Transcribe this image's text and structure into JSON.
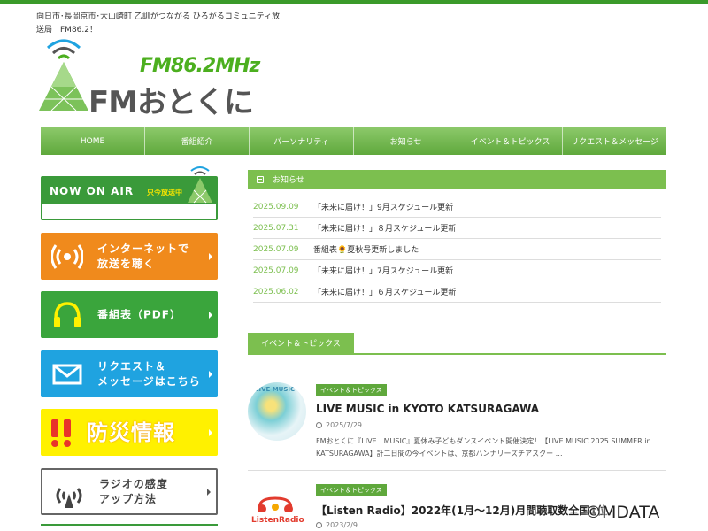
{
  "header": {
    "tagline": "向日市･長岡京市･大山崎町 乙訓がつながる ひろがるコミュニティ放送局　FM86.2！",
    "logo_frequency": "FM86.2MHz",
    "logo_name": "FMおとくに"
  },
  "nav": {
    "items": [
      "HOME",
      "番組紹介",
      "パーソナリティ",
      "お知らせ",
      "イベント＆トピックス",
      "リクエスト＆メッセージ"
    ]
  },
  "sidebar": {
    "onair_title": "NOW ON AIR",
    "onair_live": "只今放送中",
    "internet_label": "インターネットで\n放送を聴く",
    "program_label": "番組表（PDF）",
    "request_label": "リクエスト＆\nメッセージはこちら",
    "disaster_label": "防災情報",
    "radio_label": "ラジオの感度\nアップ方法"
  },
  "news": {
    "heading": "お知らせ",
    "items": [
      {
        "date": "2025.09.09",
        "title": "「未来に届け！」9月スケジュール更新"
      },
      {
        "date": "2025.07.31",
        "title": "「未来に届け！」８月スケジュール更新"
      },
      {
        "date": "2025.07.09",
        "title": "番組表🌻夏秋号更新しました"
      },
      {
        "date": "2025.07.09",
        "title": "「未来に届け！」7月スケジュール更新"
      },
      {
        "date": "2025.06.02",
        "title": "「未来に届け！」６月スケジュール更新"
      }
    ]
  },
  "events": {
    "heading": "イベント＆トピックス",
    "posts": [
      {
        "category": "イベント＆トピックス",
        "title": "LIVE MUSIC in KYOTO KATSURAGAWA",
        "date": "2025/7/29",
        "excerpt": "FMおとくに『LIVE　MUSIC』夏休み子どもダンスイベント開催決定！【LIVE MUSIC 2025 SUMMER in KATSURAGAWA】計二日間の今イベントは、京都ハンナリーズチアスクー …",
        "thumb_text": "LIVE MUSIC"
      },
      {
        "category": "イベント＆トピックス",
        "title": "【Listen Radio】2022年(1月～12月)月間聴取数全国1位",
        "date": "2023/2/9",
        "thumb_text": "ListenRadio"
      }
    ]
  },
  "watermark": "©MDATA",
  "colors": {
    "brand_green": "#3a9a2a",
    "nav_green": "#6cb247",
    "orange": "#f08a1c",
    "blue": "#1fa3e0",
    "yellow": "#fff100"
  }
}
